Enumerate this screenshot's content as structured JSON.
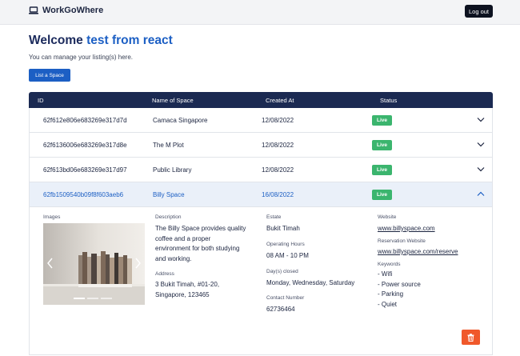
{
  "app": {
    "brand": "WorkGoWhere",
    "logout_label": "Log out"
  },
  "welcome": {
    "prefix": "Welcome",
    "username": "test from react",
    "subtitle": "You can manage your listing(s) here.",
    "list_button": "List a Space"
  },
  "table": {
    "headers": {
      "id": "ID",
      "name": "Name of Space",
      "created": "Created At",
      "status": "Status"
    },
    "rows": [
      {
        "id": "62f612e806e683269e317d7d",
        "name": "Camaca Singapore",
        "created": "12/08/2022",
        "status": "Live"
      },
      {
        "id": "62f6136006e683269e317d8e",
        "name": "The M Plot",
        "created": "12/08/2022",
        "status": "Live"
      },
      {
        "id": "62f613bd06e683269e317d97",
        "name": "Public Library",
        "created": "12/08/2022",
        "status": "Live"
      },
      {
        "id": "62fb1509540b09f8f603aeb6",
        "name": "Billy Space",
        "created": "16/08/2022",
        "status": "Live"
      }
    ]
  },
  "detail": {
    "images_label": "Images",
    "carousel": {
      "slide_count": 3,
      "active_slide": 1
    },
    "description_label": "Description",
    "description_lines": [
      "The Billy Space provides quality",
      "coffee and a proper",
      "environment for both studying",
      "and working."
    ],
    "address_label": "Address",
    "address_lines": [
      "3 Bukit Timah, #01-20,",
      "Singapore, 123465"
    ],
    "estate_label": "Estate",
    "estate": "Bukit Timah",
    "hours_label": "Operating Hours",
    "hours": "08 AM - 10 PM",
    "days_closed_label": "Day(s) closed",
    "days_closed": "Monday, Wednesday, Saturday",
    "contact_label": "Contact Number",
    "contact": "62736464",
    "website_label": "Website",
    "website": "www.billyspace.com",
    "reservation_label": "Reservation Website",
    "reservation": "www.billyspace.com/reserve",
    "keywords_label": "Keywords",
    "keywords": [
      "- Wifi",
      "- Power source",
      "- Parking",
      "- Quiet"
    ]
  },
  "icons": {
    "brand": "laptop-icon",
    "row_toggle": "chevron-down-icon",
    "row_toggle_open": "chevron-up-icon",
    "carousel_prev": "chevron-left-icon",
    "carousel_next": "chevron-right-icon",
    "delete": "trash-icon"
  },
  "colors": {
    "navy": "#1b2a52",
    "accent": "#1c5fc4",
    "live": "#3bb56e",
    "danger": "#f0582a"
  }
}
